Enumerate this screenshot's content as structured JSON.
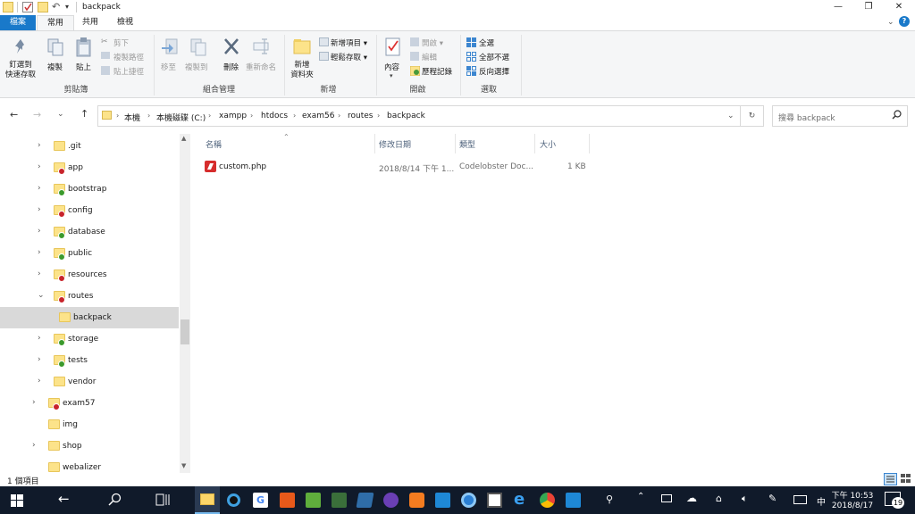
{
  "window": {
    "title": "backpack"
  },
  "ribbon_tabs": {
    "file": "檔案",
    "home": "常用",
    "share": "共用",
    "view": "檢視"
  },
  "ribbon": {
    "clipboard": {
      "pin": "釘選到\n快速存取",
      "copy": "複製",
      "paste": "貼上",
      "cut": "剪下",
      "copy_path": "複製路徑",
      "paste_shortcut": "貼上捷徑",
      "label": "剪貼簿"
    },
    "organize": {
      "move_to": "移至",
      "copy_to": "複製到",
      "delete": "刪除",
      "rename": "重新命名",
      "label": "組合管理"
    },
    "new": {
      "new_folder": "新增\n資料夾",
      "new_item": "新增項目",
      "easy_access": "輕鬆存取",
      "label": "新增"
    },
    "open": {
      "properties": "內容",
      "open": "開啟",
      "edit": "編輯",
      "history": "歷程記錄",
      "label": "開啟"
    },
    "select": {
      "select_all": "全選",
      "select_none": "全部不選",
      "invert": "反向選擇",
      "label": "選取"
    }
  },
  "address": {
    "crumbs": [
      "本機",
      "本機磁碟 (C:)",
      "xampp",
      "htdocs",
      "exam56",
      "routes",
      "backpack"
    ]
  },
  "search": {
    "placeholder": "搜尋 backpack"
  },
  "nav": [
    {
      "label": ".git",
      "level": 1,
      "expand": "›",
      "badge": ""
    },
    {
      "label": "app",
      "level": 1,
      "expand": "›",
      "badge": "red"
    },
    {
      "label": "bootstrap",
      "level": 1,
      "expand": "›",
      "badge": "green"
    },
    {
      "label": "config",
      "level": 1,
      "expand": "›",
      "badge": "red"
    },
    {
      "label": "database",
      "level": 1,
      "expand": "›",
      "badge": "green"
    },
    {
      "label": "public",
      "level": 1,
      "expand": "›",
      "badge": "green"
    },
    {
      "label": "resources",
      "level": 1,
      "expand": "›",
      "badge": "red"
    },
    {
      "label": "routes",
      "level": 1,
      "expand": "⌄",
      "badge": "red"
    },
    {
      "label": "backpack",
      "level": 2,
      "expand": "",
      "badge": "",
      "selected": true
    },
    {
      "label": "storage",
      "level": 1,
      "expand": "›",
      "badge": "green"
    },
    {
      "label": "tests",
      "level": 1,
      "expand": "›",
      "badge": "green"
    },
    {
      "label": "vendor",
      "level": 1,
      "expand": "›",
      "badge": ""
    },
    {
      "label": "exam57",
      "level": 0,
      "expand": "›",
      "badge": "red"
    },
    {
      "label": "img",
      "level": 0,
      "expand": "",
      "badge": ""
    },
    {
      "label": "shop",
      "level": 0,
      "expand": "›",
      "badge": ""
    },
    {
      "label": "webalizer",
      "level": 0,
      "expand": "",
      "badge": ""
    }
  ],
  "columns": {
    "name": "名稱",
    "modified": "修改日期",
    "type": "類型",
    "size": "大小"
  },
  "files": [
    {
      "name": "custom.php",
      "modified": "2018/8/14 下午 1...",
      "type": "Codelobster Doc...",
      "size": "1 KB"
    }
  ],
  "status": {
    "count": "1 個項目"
  },
  "taskbar": {
    "ime": "中",
    "time": "下午 10:53",
    "date": "2018/8/17",
    "notifications": "19"
  }
}
